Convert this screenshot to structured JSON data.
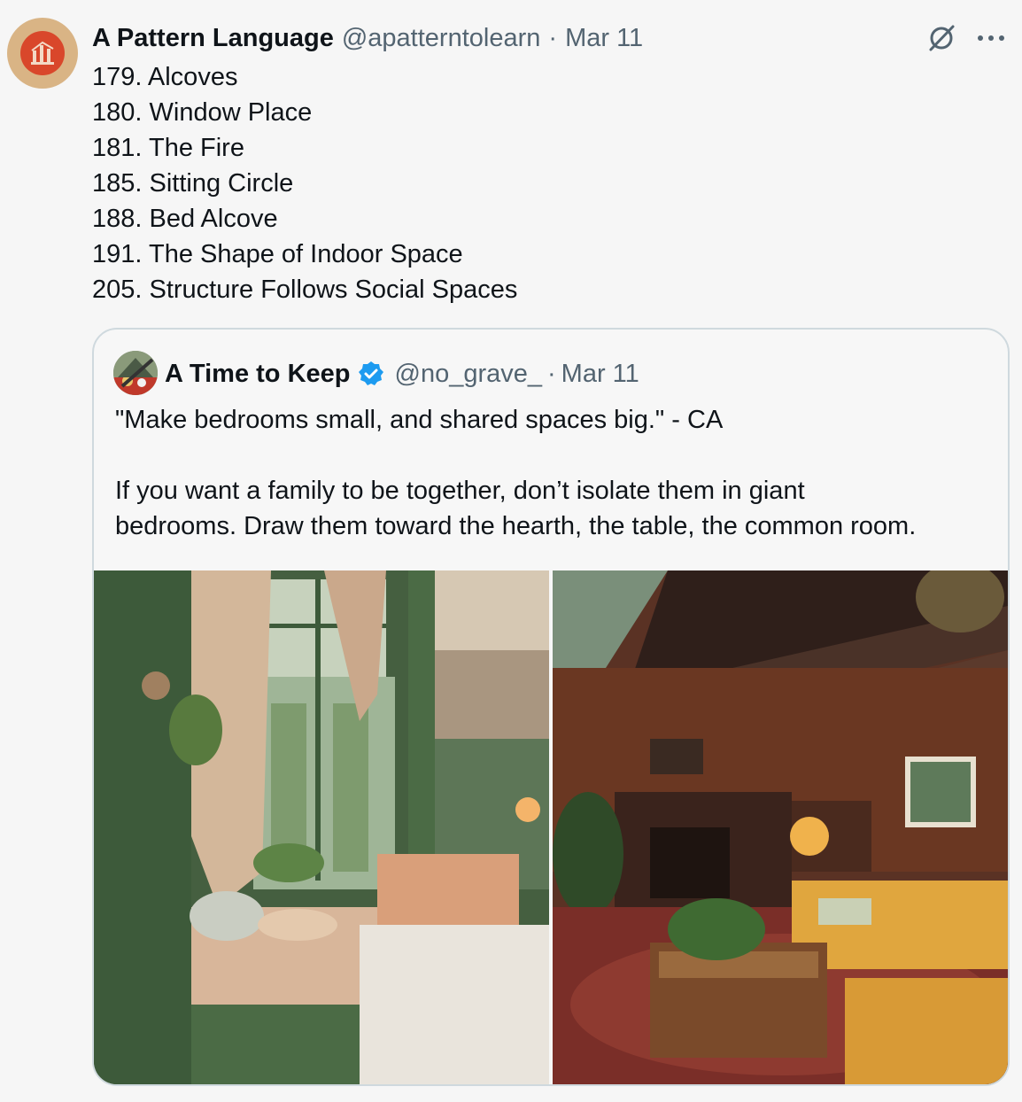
{
  "tweet": {
    "author_name": "A Pattern Language",
    "author_handle": "@apatterntolearn",
    "dot": "·",
    "date": "Mar 11",
    "avatar_icon": "pattern-language-logo",
    "lines": [
      "179. Alcoves",
      "180. Window Place",
      "181. The Fire",
      "185. Sitting Circle",
      "188. Bed Alcove",
      "191. The Shape of Indoor Space",
      "205. Structure Follows Social Spaces"
    ],
    "icons": [
      "grok-icon",
      "more-icon"
    ]
  },
  "quoted": {
    "author_name": "A Time to Keep",
    "author_handle": "@no_grave_",
    "dot": "·",
    "date": "Mar 11",
    "verified_icon": "verified-badge-icon",
    "verified_color": "#1d9bf0",
    "quote_line": "\"Make bedrooms small, and shared spaces big.\" - CA",
    "body_line_1": "If you want a family to be together, don’t isolate them in giant",
    "body_line_2": "bedrooms. Draw them toward the hearth, the table, the common room.",
    "images": [
      {
        "icon": "green-bedroom-alcove-photo"
      },
      {
        "icon": "wood-paneled-living-room-photo"
      }
    ]
  },
  "colors": {
    "text": "#0f1419",
    "secondary": "#536471",
    "border": "#cfd9de",
    "background": "#f6f6f6"
  }
}
